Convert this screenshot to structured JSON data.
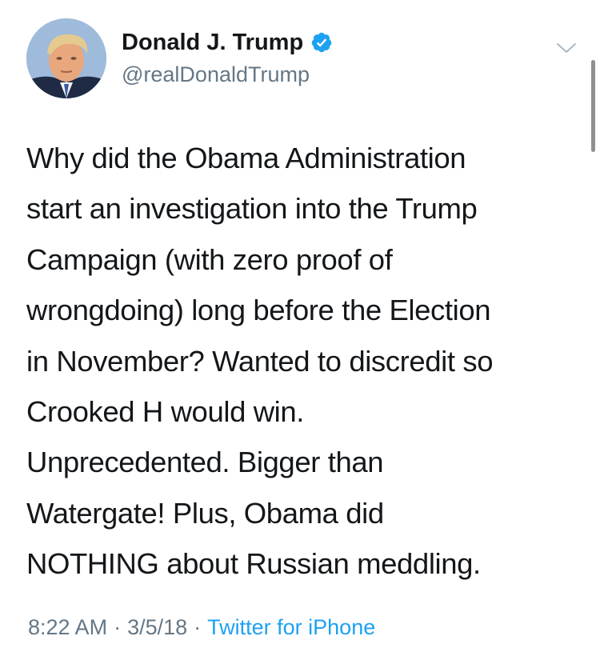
{
  "tweet": {
    "author": {
      "display_name": "Donald J. Trump",
      "handle": "@realDonaldTrump",
      "verified": true,
      "avatar_icon": "profile-photo"
    },
    "menu_icon": "chevron-down-icon",
    "text_lines": [
      "Why did the Obama Administration",
      "start an investigation into the Trump",
      "Campaign (with zero proof of",
      "wrongdoing) long before the Election",
      "in November? Wanted to discredit so",
      "Crooked H would win.",
      "Unprecedented. Bigger than",
      "Watergate! Plus, Obama did",
      "NOTHING about Russian meddling."
    ],
    "meta": {
      "time": "8:22 AM",
      "separator": "·",
      "date": "3/5/18",
      "source": "Twitter for iPhone"
    }
  },
  "colors": {
    "text": "#14171a",
    "secondary": "#657786",
    "link": "#1da1f2",
    "verified": "#1da1f2"
  }
}
